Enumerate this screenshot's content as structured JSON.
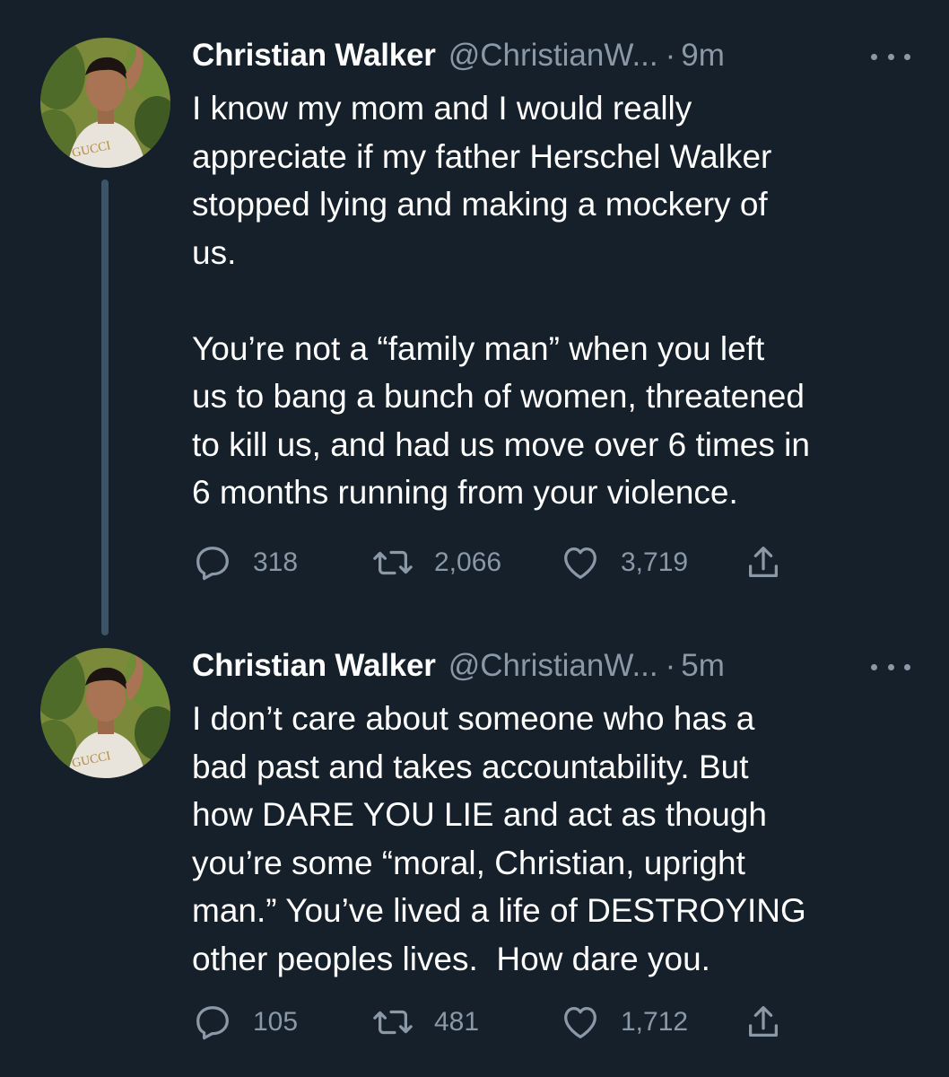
{
  "tweets": [
    {
      "author_name": "Christian Walker",
      "handle": "@ChristianW...",
      "separator": "·",
      "time": "9m",
      "text": "I know my mom and I would really\nappreciate if my father Herschel Walker\nstopped lying and making a mockery of\nus.\n\nYou’re not a “family man” when you left\nus to bang a bunch of women, threatened\nto kill us, and had us move over 6 times in\n6 months running from your violence.",
      "replies": "318",
      "retweets": "2,066",
      "likes": "3,719",
      "avatar_shirt_text": "GUCCI"
    },
    {
      "author_name": "Christian Walker",
      "handle": "@ChristianW...",
      "separator": "·",
      "time": "5m",
      "text": "I don’t care about someone who has a\nbad past and takes accountability. But\nhow DARE YOU LIE and act as though\nyou’re some “moral, Christian, upright\nman.” You’ve lived a life of DESTROYING\nother peoples lives.  How dare you.",
      "replies": "105",
      "retweets": "481",
      "likes": "1,712",
      "avatar_shirt_text": "GUCCI"
    }
  ],
  "icons": {
    "reply": "reply-icon",
    "retweet": "retweet-icon",
    "like": "like-icon",
    "share": "share-icon",
    "more": "more-icon"
  },
  "colors": {
    "background": "#15202b",
    "text": "#ffffff",
    "muted": "#8b98a5",
    "thread_line": "#3d5466"
  }
}
